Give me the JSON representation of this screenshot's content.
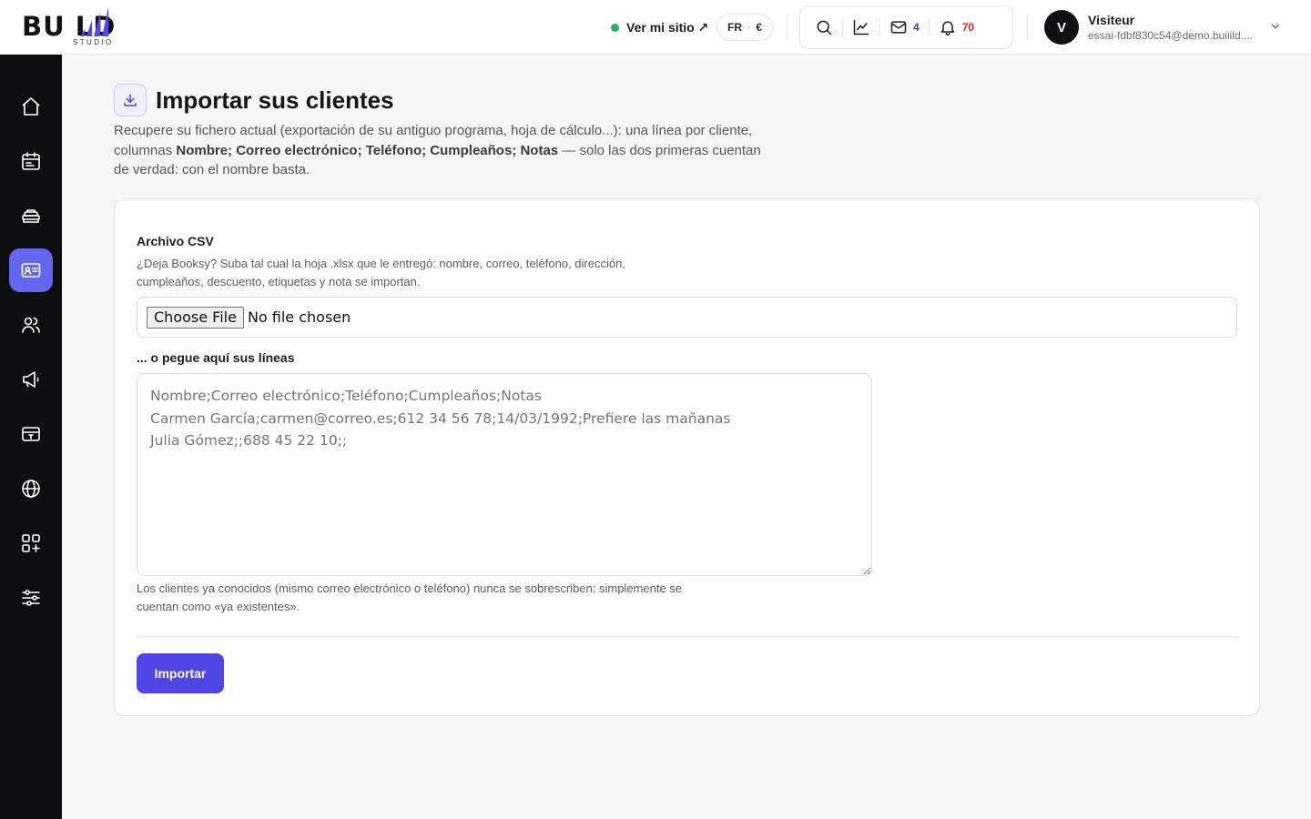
{
  "brand": {
    "logo_text": "BU LD",
    "logo_sub": "STUDIO"
  },
  "header": {
    "site_link": "Ver mi sitio ↗",
    "lang": "FR",
    "currency": "€",
    "messages_count": "4",
    "notifications_count": "70",
    "user": {
      "initial": "V",
      "name": "Visiteur",
      "email": "essai-fdbf830c54@demo.buiiild...."
    }
  },
  "sidebar": {
    "items": [
      {
        "name": "home",
        "icon": "home-icon"
      },
      {
        "name": "calendar",
        "icon": "calendar-icon"
      },
      {
        "name": "services",
        "icon": "stack-icon"
      },
      {
        "name": "clients",
        "icon": "contact-card-icon",
        "active": true
      },
      {
        "name": "team",
        "icon": "users-icon"
      },
      {
        "name": "marketing",
        "icon": "megaphone-icon"
      },
      {
        "name": "payments",
        "icon": "card-icon"
      },
      {
        "name": "website",
        "icon": "globe-icon"
      },
      {
        "name": "apps",
        "icon": "apps-plus-icon"
      },
      {
        "name": "settings",
        "icon": "sliders-icon"
      }
    ]
  },
  "page": {
    "title": "Importar sus clientes",
    "intro_prefix": "Recupere su fichero actual (exportación de su antiguo programa, hoja de cálculo...): una línea por cliente, columnas ",
    "intro_columns": "Nombre; Correo electrónico; Teléfono; Cumpleaños; Notas",
    "intro_suffix": " — solo las dos primeras cuentan de verdad: con el nombre basta."
  },
  "form": {
    "csv_label": "Archivo CSV",
    "csv_help": "¿Deja Booksy? Suba tal cual la hoja .xlsx que le entregó: nombre, correo, teléfono, dirección, cumpleaños, descuento, etiquetas y nota se importan.",
    "file_button": "Choose File",
    "file_status": "No file chosen",
    "paste_label": "... o pegue aquí sus líneas",
    "paste_placeholder": "Nombre;Correo electrónico;Teléfono;Cumpleaños;Notas\nCarmen García;carmen@correo.es;612 34 56 78;14/03/1992;Prefiere las mañanas\nJulia Gómez;;688 45 22 10;;",
    "paste_help": "Los clientes ya conocidos (mismo correo electrónico o teléfono) nunca se sobrescriben: simplemente se cuentan como «ya existentes».",
    "submit_label": "Importar"
  },
  "colors": {
    "accent": "#4f46e5",
    "sidebar_active": "#6366f1",
    "sidebar_bg": "#0e0e11",
    "online": "#22b35e",
    "alert": "#dc2626"
  }
}
